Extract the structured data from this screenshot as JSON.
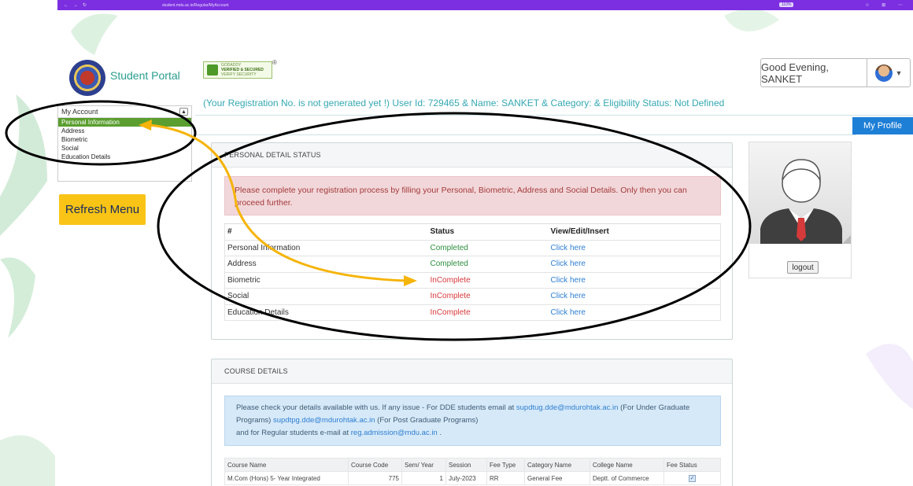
{
  "browser": {
    "url": "student.mdu.ac.in/Regular/MyAccount",
    "zoom": "110%"
  },
  "header": {
    "portal_name": "Student Portal",
    "badge_top": "GODADDY",
    "badge_main": "VERIFIED & SECURED",
    "badge_sub": "VERIFY SECURITY",
    "badge_reg": "®",
    "greeting": "Good Evening, SANKET",
    "reg_info": "(Your Registration No. is not generated yet !) User Id: 729465 & Name: SANKET & Category: & Eligibility Status: Not Defined",
    "my_profile": "My Profile"
  },
  "sidebar": {
    "title": "My Account",
    "items": [
      {
        "label": "Personal Information"
      },
      {
        "label": "Address"
      },
      {
        "label": "Biometric"
      },
      {
        "label": "Social"
      },
      {
        "label": "Education Details"
      }
    ],
    "refresh": "Refresh Menu"
  },
  "personal_detail": {
    "title": "PERSONAL DETAIL STATUS",
    "alert": "Please complete your registration process by filling your Personal, Biometric, Address and Social Details. Only then you can proceed further.",
    "headers": [
      "#",
      "Status",
      "View/Edit/Insert"
    ],
    "rows": [
      {
        "name": "Personal Information",
        "status": "Completed",
        "action": "Click here"
      },
      {
        "name": "Address",
        "status": "Completed",
        "action": "Click here"
      },
      {
        "name": "Biometric",
        "status": "InComplete",
        "action": "Click here"
      },
      {
        "name": "Social",
        "status": "InComplete",
        "action": "Click here"
      },
      {
        "name": "Education Details",
        "status": "InComplete",
        "action": "Click here"
      }
    ]
  },
  "course_details": {
    "title": "COURSE DETAILS",
    "alert_1": "Please check your details available with us. If any issue - For DDE students email at",
    "email_1": "supdtug.dde@mdurohtak.ac.in",
    "alert_2": "(For Under Graduate Programs)",
    "email_2": "supdtpg.dde@mdurohtak.ac.in",
    "alert_3": "(For Post Graduate Programs)",
    "alert_4": "and for Regular students e-mail at",
    "email_3": "reg.admission@mdu.ac.in",
    "alert_5": ".",
    "headers": [
      "Course Name",
      "Course Code",
      "Sem/ Year",
      "Session",
      "Fee Type",
      "Category Name",
      "College Name",
      "Fee Status"
    ],
    "rows": [
      {
        "course_name": "M.Com (Hons) 5- Year Integrated",
        "course_code": "775",
        "sem_year": "1",
        "session": "July-2023",
        "fee_type": "RR",
        "category": "General Fee",
        "college": "Deptt. of Commerce",
        "fee_status": "✓"
      }
    ]
  },
  "profile": {
    "logout": "logout"
  },
  "colors": {
    "accent_green": "#5a9e2f",
    "teal_text": "#35a8b3",
    "annotation_arrow": "#f5b40a"
  }
}
